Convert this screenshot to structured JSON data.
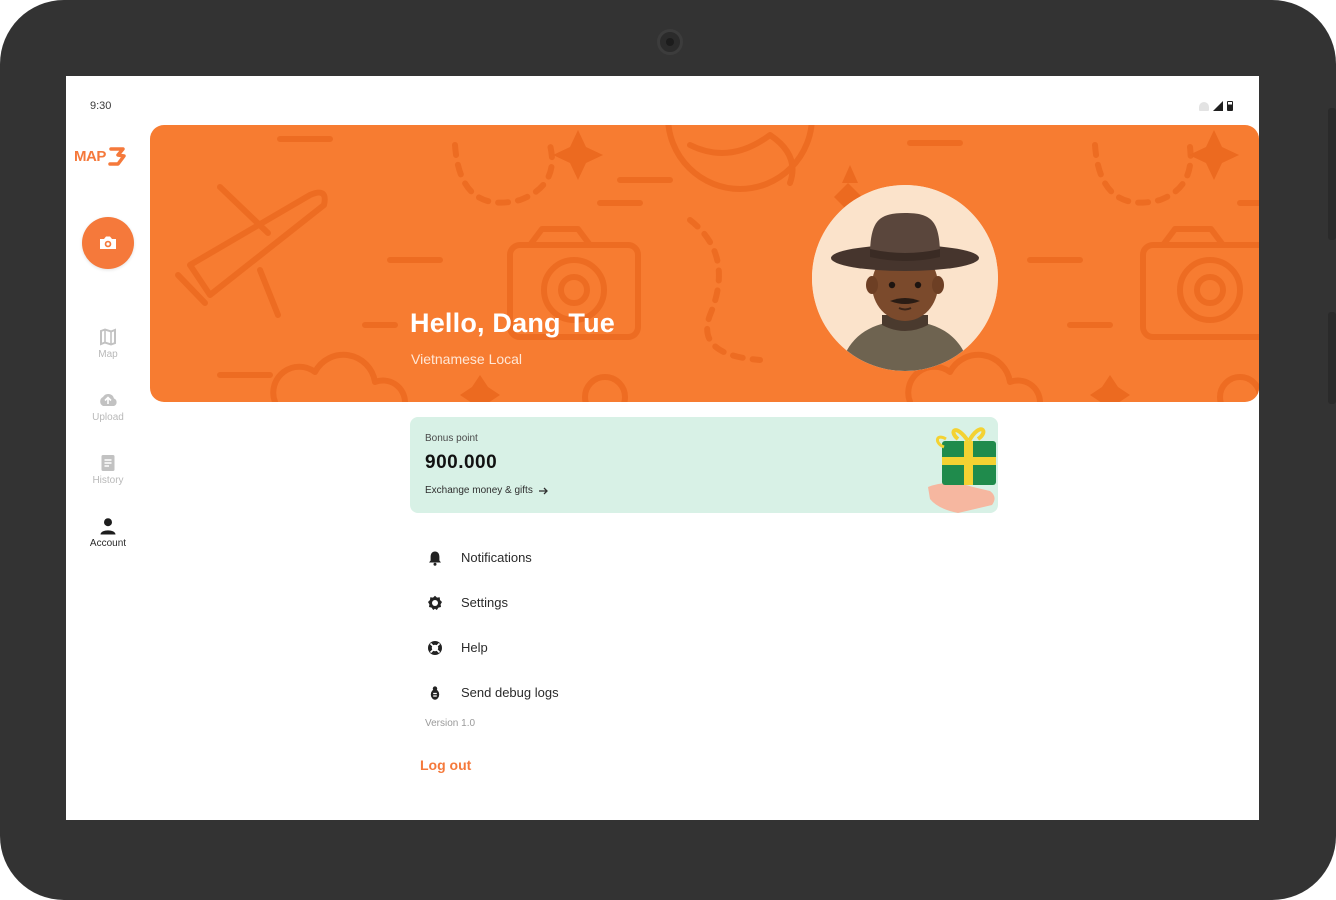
{
  "status_bar": {
    "time": "9:30"
  },
  "brand": {
    "logo_text": "MAP",
    "accent_color": "#f5793b"
  },
  "nav_rail": {
    "fab_icon": "camera-icon",
    "items": [
      {
        "label": "Map",
        "icon": "map-icon",
        "active": false
      },
      {
        "label": "Upload",
        "icon": "upload-icon",
        "active": false
      },
      {
        "label": "History",
        "icon": "history-icon",
        "active": false
      },
      {
        "label": "Account",
        "icon": "person-icon",
        "active": true
      }
    ]
  },
  "profile": {
    "greeting": "Hello, Dang Tue",
    "subtitle": "Vietnamese Local",
    "banner_color": "#f77c31"
  },
  "bonus": {
    "label": "Bonus point",
    "value": "900.000",
    "link_text": "Exchange money & gifts",
    "card_color": "#d8f1e6"
  },
  "menu": [
    {
      "label": "Notifications",
      "icon": "bell-icon"
    },
    {
      "label": "Settings",
      "icon": "gear-icon"
    },
    {
      "label": "Help",
      "icon": "help-icon"
    },
    {
      "label": "Send debug logs",
      "icon": "bug-icon"
    }
  ],
  "version_text": "Version 1.0",
  "logout_label": "Log out"
}
